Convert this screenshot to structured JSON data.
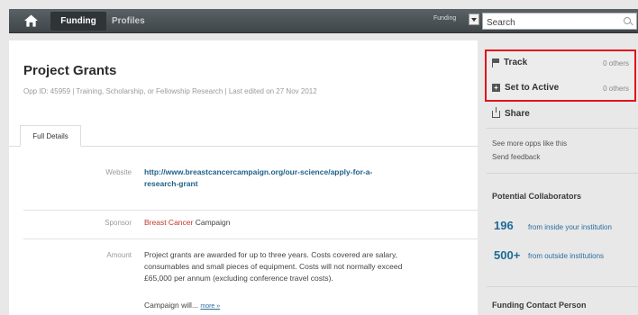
{
  "nav": {
    "home_icon": "home-icon",
    "funding_label": "Funding",
    "profiles_label": "Profiles",
    "search_scope": "Funding",
    "search_placeholder": "Search"
  },
  "opportunity": {
    "title": "Project Grants",
    "meta": "Opp ID: 45959  |  Training, Scholarship, or Fellowship Research  |  Last edited on 27 Nov 2012",
    "tab": "Full Details",
    "website_label": "Website",
    "website_line1": "http://www.breastcancercampaign.org/our-science/apply-for-a-",
    "website_line2": "research-grant",
    "sponsor_label": "Sponsor",
    "sponsor_red": "Breast Cancer",
    "sponsor_rest": " Campaign",
    "amount_label": "Amount",
    "amount_line1": "Project grants are awarded for up to three years. Costs covered are salary,",
    "amount_line2": "consumables and small pieces of equipment. Costs will not normally exceed",
    "amount_line3": "£65,000 per annum (excluding conference travel costs).",
    "amount_line4": "Campaign will...",
    "more_label": "more »"
  },
  "sidebar": {
    "track_label": "Track",
    "track_count": "0 others",
    "active_label": "Set to Active",
    "active_count": "0 others",
    "share_label": "Share",
    "see_more": "See more opps like this",
    "feedback": "Send feedback",
    "collab_heading": "Potential Collaborators",
    "inside_count": "196",
    "inside_text": "from inside your institution",
    "outside_count": "500+",
    "outside_text": "from outside institutions",
    "contact_heading": "Funding Contact Person"
  },
  "colors": {
    "highlight_border": "#e3141b",
    "link": "#1f5f88",
    "sponsor_red": "#c0392b"
  }
}
